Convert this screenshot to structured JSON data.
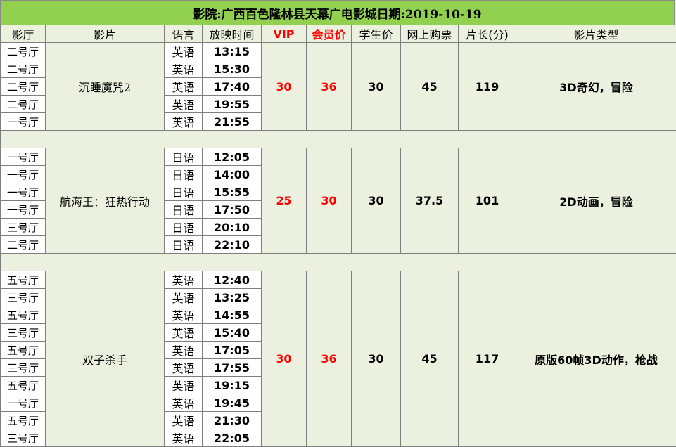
{
  "title": "影院:广西百色隆林县天幕广电影城日期:2019-10-19",
  "headers": {
    "hall": "影厅",
    "film": "影片",
    "lang": "语言",
    "time": "放映时间",
    "vip": "VIP",
    "member": "会员价",
    "student": "学生价",
    "online": "网上购票",
    "length": "片长(分)",
    "genre": "影片类型"
  },
  "colors": {
    "title_bg": "#92D050",
    "sheet_bg": "#EBF1DE",
    "price_red": "#FF0000"
  },
  "movies": [
    {
      "film": "沉睡魔咒2",
      "vip": "30",
      "member": "36",
      "student": "30",
      "online": "45",
      "length": "119",
      "genre": "3D奇幻，冒险",
      "shows": [
        {
          "hall": "二号厅",
          "lang": "英语",
          "time": "13:15"
        },
        {
          "hall": "二号厅",
          "lang": "英语",
          "time": "15:30"
        },
        {
          "hall": "二号厅",
          "lang": "英语",
          "time": "17:40"
        },
        {
          "hall": "二号厅",
          "lang": "英语",
          "time": "19:55"
        },
        {
          "hall": "一号厅",
          "lang": "英语",
          "time": "21:55"
        }
      ]
    },
    {
      "film": "航海王：狂热行动",
      "vip": "25",
      "member": "30",
      "student": "30",
      "online": "37.5",
      "length": "101",
      "genre": "2D动画，冒险",
      "shows": [
        {
          "hall": "一号厅",
          "lang": "日语",
          "time": "12:05"
        },
        {
          "hall": "一号厅",
          "lang": "日语",
          "time": "14:00"
        },
        {
          "hall": "一号厅",
          "lang": "日语",
          "time": "15:55"
        },
        {
          "hall": "一号厅",
          "lang": "日语",
          "time": "17:50"
        },
        {
          "hall": "三号厅",
          "lang": "日语",
          "time": "20:10"
        },
        {
          "hall": "二号厅",
          "lang": "日语",
          "time": "22:10"
        }
      ]
    },
    {
      "film": "双子杀手",
      "vip": "30",
      "member": "36",
      "student": "30",
      "online": "45",
      "length": "117",
      "genre": "原版60帧3D动作，枪战",
      "shows": [
        {
          "hall": "五号厅",
          "lang": "英语",
          "time": "12:40"
        },
        {
          "hall": "三号厅",
          "lang": "英语",
          "time": "13:25"
        },
        {
          "hall": "五号厅",
          "lang": "英语",
          "time": "14:55"
        },
        {
          "hall": "三号厅",
          "lang": "英语",
          "time": "15:40"
        },
        {
          "hall": "五号厅",
          "lang": "英语",
          "time": "17:05"
        },
        {
          "hall": "三号厅",
          "lang": "英语",
          "time": "17:55"
        },
        {
          "hall": "五号厅",
          "lang": "英语",
          "time": "19:15"
        },
        {
          "hall": "一号厅",
          "lang": "英语",
          "time": "19:45"
        },
        {
          "hall": "五号厅",
          "lang": "英语",
          "time": "21:30"
        },
        {
          "hall": "三号厅",
          "lang": "英语",
          "time": "22:05"
        }
      ]
    }
  ]
}
